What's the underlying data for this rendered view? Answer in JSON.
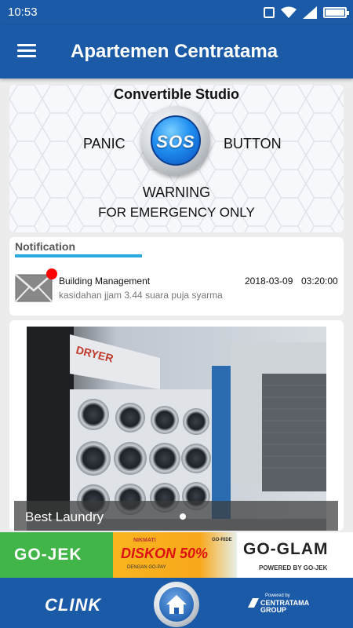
{
  "status_bar": {
    "time": "10:53",
    "icons": [
      "message-icon",
      "wifi-icon",
      "signal-icon",
      "battery-icon"
    ]
  },
  "app_bar": {
    "title": "Apartemen Centratama",
    "menu_icon": "hamburger-menu-icon",
    "color": "#1b5aa6"
  },
  "sos_panel": {
    "unit_name": "Convertible Studio",
    "panic_label": "PANIC",
    "button_label": "BUTTON",
    "sos_text": "SOS",
    "warning_line1": "WARNING",
    "warning_line2": "FOR EMERGENCY ONLY"
  },
  "notification": {
    "heading": "Notification",
    "accent": "#29a9e0",
    "items": [
      {
        "sender": "Building Management",
        "date": "2018-03-09",
        "time": "03:20:00",
        "message": "kasidahan jjam 3.44 suara puja syarma",
        "icon": "mail-envelope-icon",
        "unread": true
      }
    ]
  },
  "gallery": {
    "caption": "Best Laundry",
    "photo_sign": "DRYER",
    "page_count": 1,
    "active_page": 1
  },
  "ads": {
    "gojek": "GO-JEK",
    "promo_small": "NIKMATI",
    "promo_big": "DISKON 50%",
    "promo_foot": "DENGAN GO-PAY",
    "goride": "GO-RIDE",
    "goglam": "GO-GLAM",
    "goglam_foot": "POWERED BY GO-JEK"
  },
  "bottom_bar": {
    "brand": "CLINK",
    "home_icon": "home-icon",
    "powered_by": "Powered by",
    "partner_line1": "CENTRATAMA",
    "partner_line2": "GROUP"
  }
}
